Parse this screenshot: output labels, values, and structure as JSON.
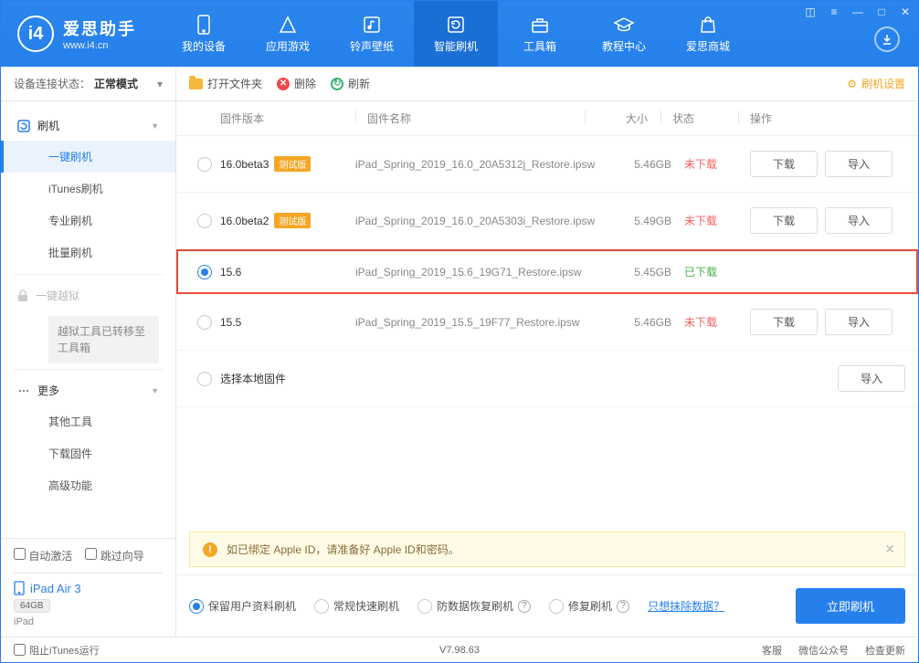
{
  "app": {
    "title": "爱思助手",
    "url": "www.i4.cn"
  },
  "nav": {
    "tabs": [
      {
        "label": "我的设备"
      },
      {
        "label": "应用游戏"
      },
      {
        "label": "铃声壁纸"
      },
      {
        "label": "智能刷机"
      },
      {
        "label": "工具箱"
      },
      {
        "label": "教程中心"
      },
      {
        "label": "爱思商城"
      }
    ],
    "active": 3
  },
  "sidebar": {
    "status_label": "设备连接状态：",
    "status_value": "正常模式",
    "section_flash": "刷机",
    "items_flash": [
      "一键刷机",
      "iTunes刷机",
      "专业刷机",
      "批量刷机"
    ],
    "jailbreak": "一键越狱",
    "jailbreak_note": "越狱工具已转移至工具箱",
    "section_more": "更多",
    "items_more": [
      "其他工具",
      "下载固件",
      "高级功能"
    ],
    "auto_activate": "自动激活",
    "skip_guide": "跳过向导",
    "device_name": "iPad Air 3",
    "device_storage": "64GB",
    "device_type": "iPad"
  },
  "toolbar": {
    "open_folder": "打开文件夹",
    "delete": "删除",
    "refresh": "刷新",
    "settings": "刷机设置"
  },
  "columns": {
    "version": "固件版本",
    "name": "固件名称",
    "size": "大小",
    "status": "状态",
    "actions": "操作"
  },
  "firmware": [
    {
      "version": "16.0beta3",
      "beta": "测试版",
      "name": "iPad_Spring_2019_16.0_20A5312j_Restore.ipsw",
      "size": "5.46GB",
      "status": "未下载",
      "downloaded": false,
      "selected": false
    },
    {
      "version": "16.0beta2",
      "beta": "测试版",
      "name": "iPad_Spring_2019_16.0_20A5303i_Restore.ipsw",
      "size": "5.49GB",
      "status": "未下载",
      "downloaded": false,
      "selected": false
    },
    {
      "version": "15.6",
      "beta": "",
      "name": "iPad_Spring_2019_15.6_19G71_Restore.ipsw",
      "size": "5.45GB",
      "status": "已下载",
      "downloaded": true,
      "selected": true
    },
    {
      "version": "15.5",
      "beta": "",
      "name": "iPad_Spring_2019_15.5_19F77_Restore.ipsw",
      "size": "5.46GB",
      "status": "未下载",
      "downloaded": false,
      "selected": false
    }
  ],
  "local_fw": "选择本地固件",
  "buttons": {
    "download": "下载",
    "import": "导入"
  },
  "notice": "如已绑定 Apple ID，请准备好 Apple ID和密码。",
  "flash_options": {
    "keep_data": "保留用户资料刷机",
    "normal": "常规快速刷机",
    "recovery": "防数据恢复刷机",
    "repair": "修复刷机",
    "erase_only": "只想抹除数据？",
    "flash_now": "立即刷机"
  },
  "footer": {
    "block_itunes": "阻止iTunes运行",
    "version": "V7.98.63",
    "support": "客服",
    "wechat": "微信公众号",
    "update": "检查更新"
  }
}
